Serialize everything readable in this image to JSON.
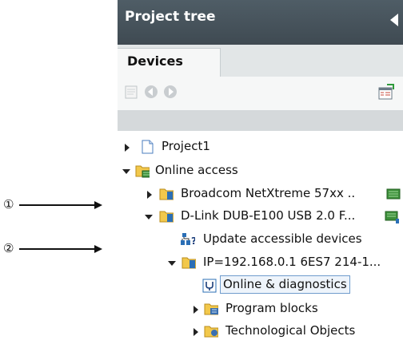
{
  "panel": {
    "title": "Project tree"
  },
  "tabs": [
    {
      "label": "Devices"
    }
  ],
  "tree": {
    "project": "Project1",
    "online_access": "Online access",
    "broadcom": "Broadcom NetXtreme 57xx ..",
    "dlink": "D-Link DUB-E100 USB 2.0 F...",
    "update": "Update accessible devices",
    "ip": "IP=192.168.0.1 6ES7 214-1...",
    "online_diag": "Online & diagnostics",
    "program_blocks": "Program blocks",
    "tech_objects": "Technological Objects"
  },
  "callouts": {
    "one": "①",
    "two": "②"
  },
  "colors": {
    "title_bg": "#45525b",
    "folder": "#f2c84b",
    "selected_border": "#6f9ccc"
  }
}
